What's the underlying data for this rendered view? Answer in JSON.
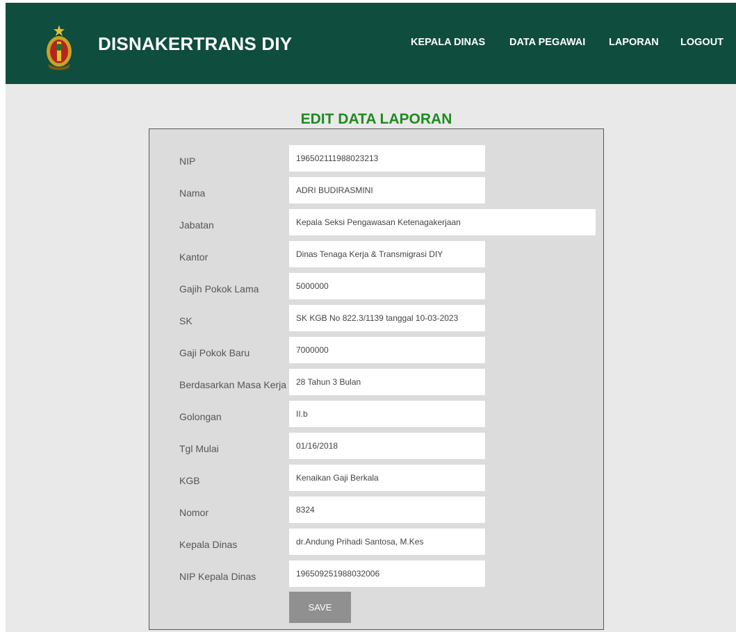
{
  "header": {
    "brand": "DISNAKERTRANS DIY",
    "nav": [
      "KEPALA DINAS",
      "DATA PEGAWAI",
      "LAPORAN",
      "LOGOUT"
    ]
  },
  "page_title": "EDIT DATA LAPORAN",
  "form": {
    "fields": [
      {
        "label": "NIP",
        "value": "196502111988023213"
      },
      {
        "label": "Nama",
        "value": "ADRI BUDIRASMINI"
      },
      {
        "label": "Jabatan",
        "value": "Kepala Seksi Pengawasan Ketenagakerjaan"
      },
      {
        "label": "Kantor",
        "value": "Dinas Tenaga Kerja & Transmigrasi DIY"
      },
      {
        "label": "Gajih Pokok Lama",
        "value": "5000000"
      },
      {
        "label": "SK",
        "value": "SK KGB No 822.3/1139 tanggal 10-03-2023"
      },
      {
        "label": "Gaji Pokok Baru",
        "value": "7000000"
      },
      {
        "label": "Berdasarkan Masa Kerja",
        "value": "28 Tahun 3 Bulan"
      },
      {
        "label": "Golongan",
        "value": "II.b"
      },
      {
        "label": "Tgl Mulai",
        "value": "01/16/2018"
      },
      {
        "label": "KGB",
        "value": "Kenaikan Gaji Berkala"
      },
      {
        "label": "Nomor",
        "value": "8324"
      },
      {
        "label": "Kepala Dinas",
        "value": "dr.Andung Prihadi Santosa, M.Kes"
      },
      {
        "label": "NIP Kepala Dinas",
        "value": "196509251988032006"
      }
    ],
    "save_label": "SAVE"
  },
  "colors": {
    "navbar": "#0f4d3e",
    "title": "#1f8a1f",
    "button": "#909090"
  }
}
